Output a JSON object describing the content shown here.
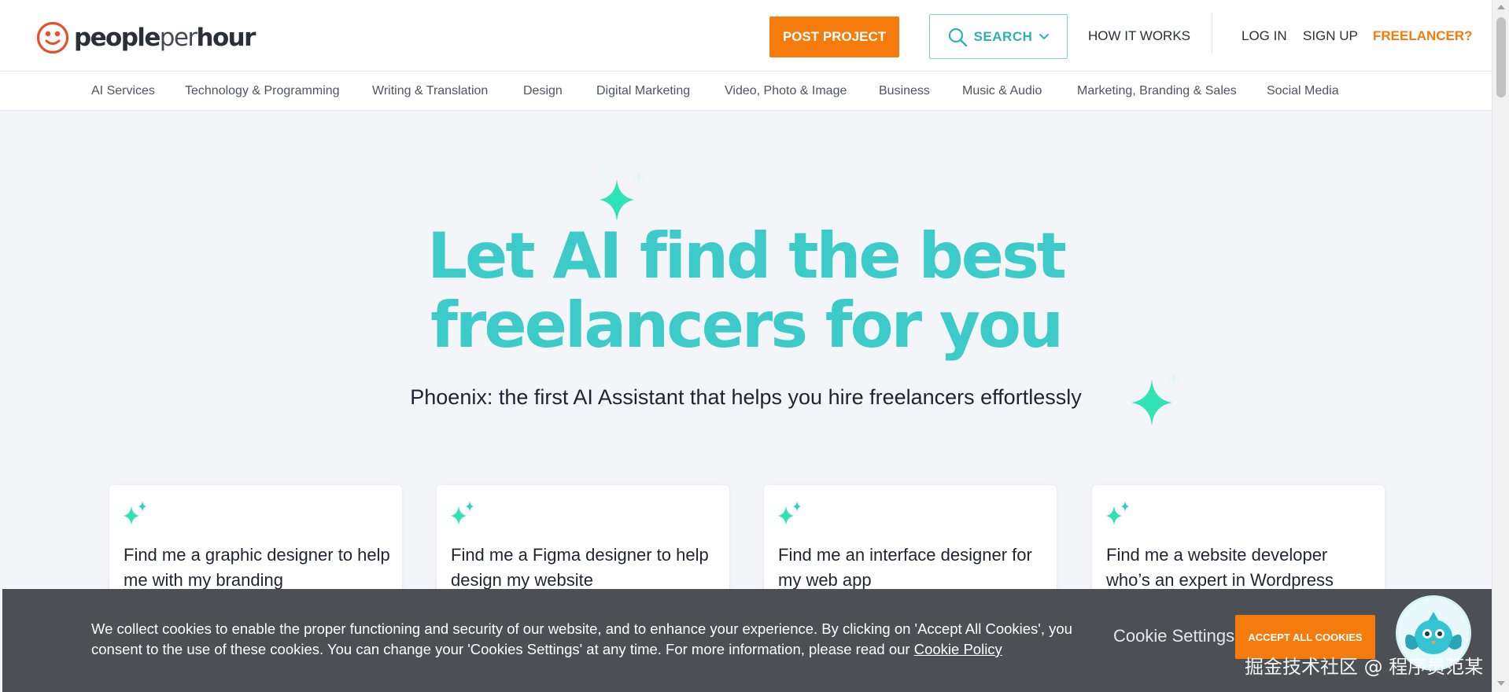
{
  "brand": {
    "name_bold": "people",
    "name_light": "per",
    "name_bold2": "hour"
  },
  "header": {
    "post_project": "POST PROJECT",
    "search": "SEARCH",
    "how_it_works": "HOW IT WORKS",
    "log_in": "LOG IN",
    "sign_up": "SIGN UP",
    "freelancer": "FREELANCER?"
  },
  "categories": [
    "AI Services",
    "Technology & Programming",
    "Writing & Translation",
    "Design",
    "Digital Marketing",
    "Video, Photo & Image",
    "Business",
    "Music & Audio",
    "Marketing, Branding & Sales",
    "Social Media"
  ],
  "hero": {
    "title_line1": "Let AI find the best",
    "title_line2": "freelancers for you",
    "subtitle": "Phoenix: the first AI Assistant that helps you hire freelancers effortlessly"
  },
  "cards": [
    {
      "text": "Find me a graphic designer to help me with my branding"
    },
    {
      "text": "Find me a Figma designer to help design my website"
    },
    {
      "text": "Find me an interface designer for my web app"
    },
    {
      "text": "Find me a website developer who’s an expert in Wordpress"
    }
  ],
  "cookie": {
    "text": "We collect cookies to enable the proper functioning and security of our website, and to enhance your experience. By clicking on 'Accept All Cookies', you consent to the use of these cookies. You can change your 'Cookies Settings' at any time. For more information, please read our",
    "policy_link": "Cookie Policy",
    "settings": "Cookie Settings",
    "accept": "ACCEPT ALL COOKIES"
  },
  "watermark": "掘金技术社区 @ 程序员范某",
  "colors": {
    "accent_orange": "#f57c0c",
    "teal": "#3ccbc8",
    "sparkle": "#2fe3b6",
    "banner": "#4c4f53"
  },
  "icons": [
    "smiley-logo-icon",
    "search-icon",
    "chevron-down-icon",
    "sparkle-icon",
    "phoenix-bot-icon"
  ]
}
